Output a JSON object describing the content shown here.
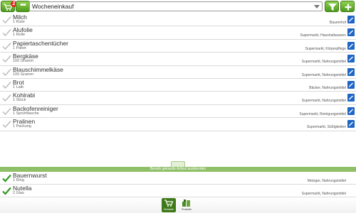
{
  "toolbar": {
    "list_icon": "shopping-cart-icon",
    "notification_count": "2",
    "more_label": "•••",
    "list_select_value": "Wocheneinkauf",
    "filter_icon": "filter-icon",
    "add_icon": "plus-icon"
  },
  "open_items": [
    {
      "name": "Milch",
      "quantity": "1 Kiste",
      "category": "Bauernhof"
    },
    {
      "name": "Alufolie",
      "quantity": "1 Rolle",
      "category": "Supermarkt, Haushaltswaren"
    },
    {
      "name": "Papiertaschentücher",
      "quantity": "1 Paket",
      "category": "Supermarkt, Körperpflege"
    },
    {
      "name": "Bergkäse",
      "quantity": "100 Gramm",
      "category": "Supermarkt, Nahrungsmittel"
    },
    {
      "name": "Blauschimmelkäse",
      "quantity": "100 Gramm",
      "category": "Supermarkt, Nahrungsmittel"
    },
    {
      "name": "Brot",
      "quantity": "1 Laib",
      "category": "Bäcker, Nahrungsmittel"
    },
    {
      "name": "Kohlrabi",
      "quantity": "1 Stück",
      "category": "Supermarkt, Nahrungsmittel"
    },
    {
      "name": "Backofenreiniger",
      "quantity": "1 Sprühflasche",
      "category": "Supermarkt, Reinigungsmittel"
    },
    {
      "name": "Pralinen",
      "quantity": "1 Packung",
      "category": "Supermarkt, Süßigkeiten"
    }
  ],
  "divider_text": "Bereits gekaufte Artikel ausblenden",
  "bought_items": [
    {
      "name": "Bauernwurst",
      "quantity": "1 Ring",
      "category": "Metzger, Nahrungsmittel"
    },
    {
      "name": "Nutella",
      "quantity": "2 Glas",
      "category": "Supermarkt, Nahrungsmittel"
    }
  ],
  "bottom_nav": [
    {
      "label": "Einkäufe",
      "icon": "cart-icon",
      "active": true
    },
    {
      "label": "Produkte",
      "icon": "products-icon",
      "active": false
    }
  ],
  "colors": {
    "accent_green": "#5aa827",
    "edit_blue": "#1f66c4",
    "check_open": "#b9b9b9",
    "check_done": "#2f9a1f"
  }
}
